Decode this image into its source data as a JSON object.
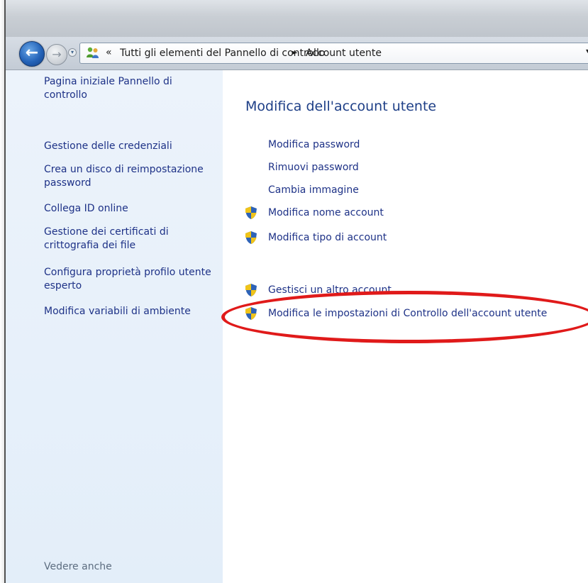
{
  "address_bar": {
    "chevrons": "«",
    "crumbs": [
      "Tutti gli elementi del Pannello di controllo",
      "Account utente"
    ],
    "separator": "►"
  },
  "sidebar": {
    "links": [
      "Pagina iniziale Pannello di controllo",
      "Gestione delle credenziali",
      "Crea un disco di reimpostazione password",
      "Collega ID online",
      "Gestione dei certificati di crittografia dei file",
      "Configura proprietà profilo utente esperto",
      "Modifica variabili di ambiente"
    ],
    "footer": "Vedere anche"
  },
  "main": {
    "title": "Modifica dell'account utente",
    "tasks": [
      "Modifica password",
      "Rimuovi password",
      "Cambia immagine",
      "Modifica nome account",
      "Modifica tipo di account"
    ],
    "more_tasks": [
      "Gestisci un altro account",
      "Modifica le impostazioni di Controllo dell'account utente"
    ]
  },
  "colors": {
    "link": "#1e3287",
    "title": "#1e3f87",
    "sidebar_bg": "#e3eef9",
    "highlight": "#e01a1a"
  }
}
